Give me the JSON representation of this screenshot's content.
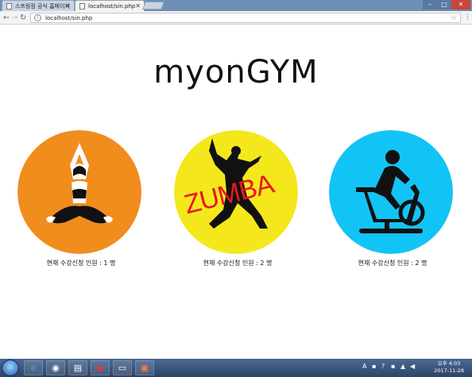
{
  "browser": {
    "tabs": [
      {
        "title": "스프링짐 공식 홈페이지"
      },
      {
        "title": "localhost/sin.php"
      }
    ],
    "url": "localhost/sin.php"
  },
  "page": {
    "site_title": "myonGYM",
    "cards": [
      {
        "name": "yoga",
        "count_label": "현재 수강신청 인원 : 1 명",
        "color": "#f08d1d"
      },
      {
        "name": "zumba",
        "zumba_text": "ZUMBA",
        "count_label": "현재 수강신청 인원 : 2 명",
        "color": "#f4e81c"
      },
      {
        "name": "spinning",
        "count_label": "현재 수강신청 인원 : 2 명",
        "color": "#12c4f5"
      }
    ]
  },
  "taskbar": {
    "time": "오후 4:03",
    "date": "2017-11-28",
    "ime_label": "A"
  }
}
